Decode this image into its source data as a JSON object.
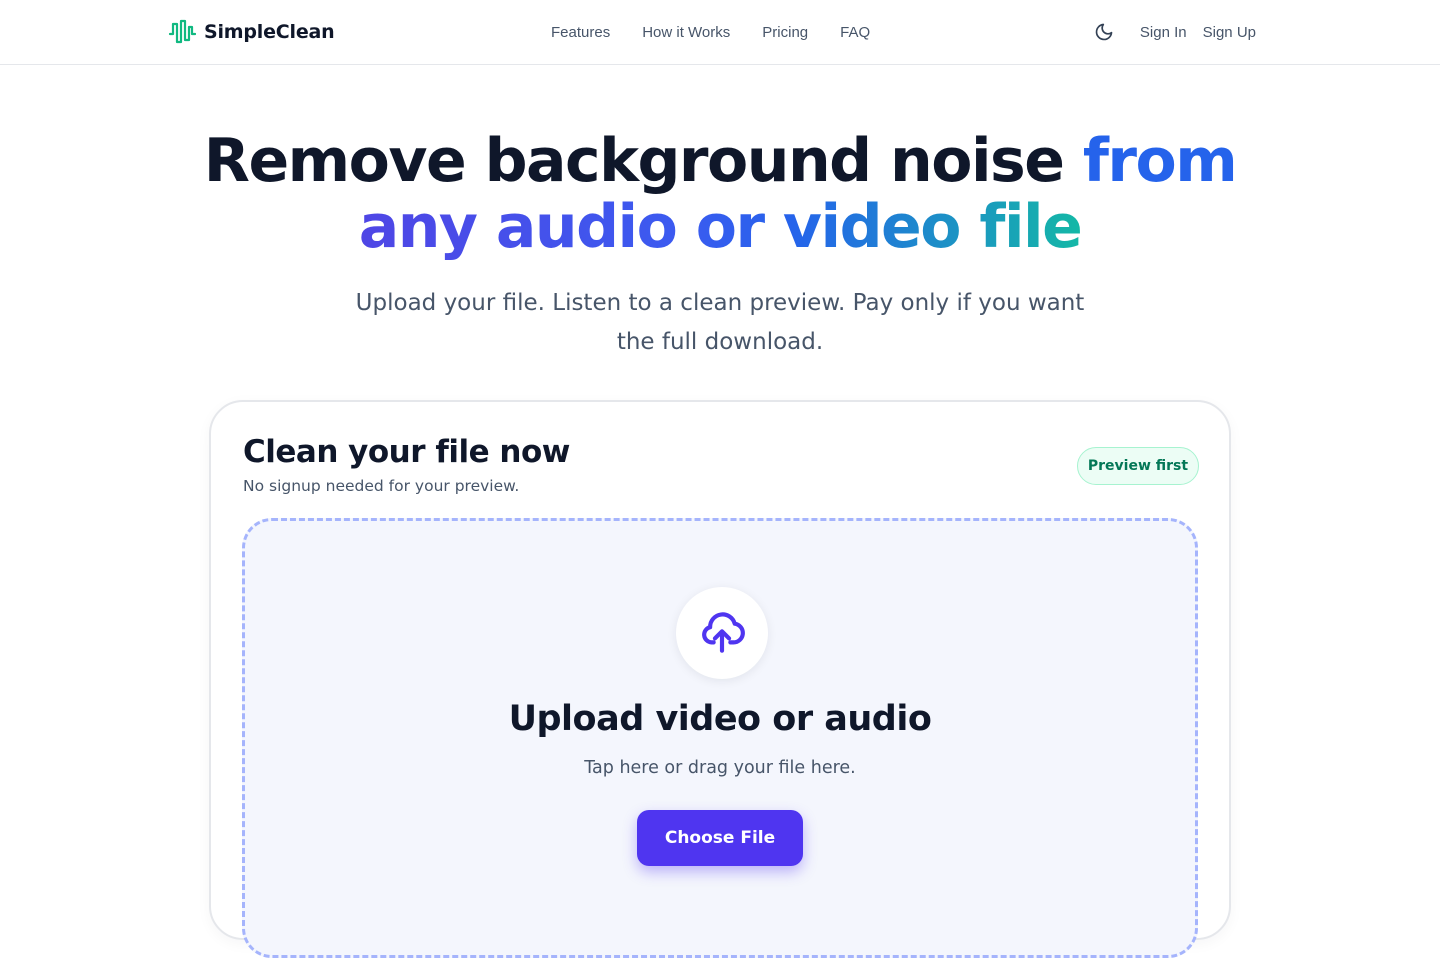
{
  "header": {
    "brand_name": "SimpleClean",
    "brand_icon": "waveform-icon",
    "nav": [
      "Features",
      "How it Works",
      "Pricing",
      "FAQ"
    ],
    "theme_icon": "moon-icon",
    "sign_in": "Sign In",
    "sign_up": "Sign Up"
  },
  "hero": {
    "title_dark": "Remove background noise",
    "title_accent": "from",
    "title_line2": "any audio or video file",
    "subtitle": "Upload your file. Listen to a clean preview. Pay only if you want the full download."
  },
  "card": {
    "title": "Clean your file now",
    "subtitle": "No signup needed for your preview.",
    "badge": "Preview first",
    "dropzone": {
      "icon": "cloud-upload-icon",
      "title": "Upload video or audio",
      "subtitle": "Tap here or drag your file here.",
      "button": "Choose File"
    }
  },
  "colors": {
    "brand_green": "#10b981",
    "accent_blue": "#2563eb",
    "accent_indigo": "#4f35f0",
    "accent_teal": "#14b8a6",
    "badge_green": "#047857"
  }
}
